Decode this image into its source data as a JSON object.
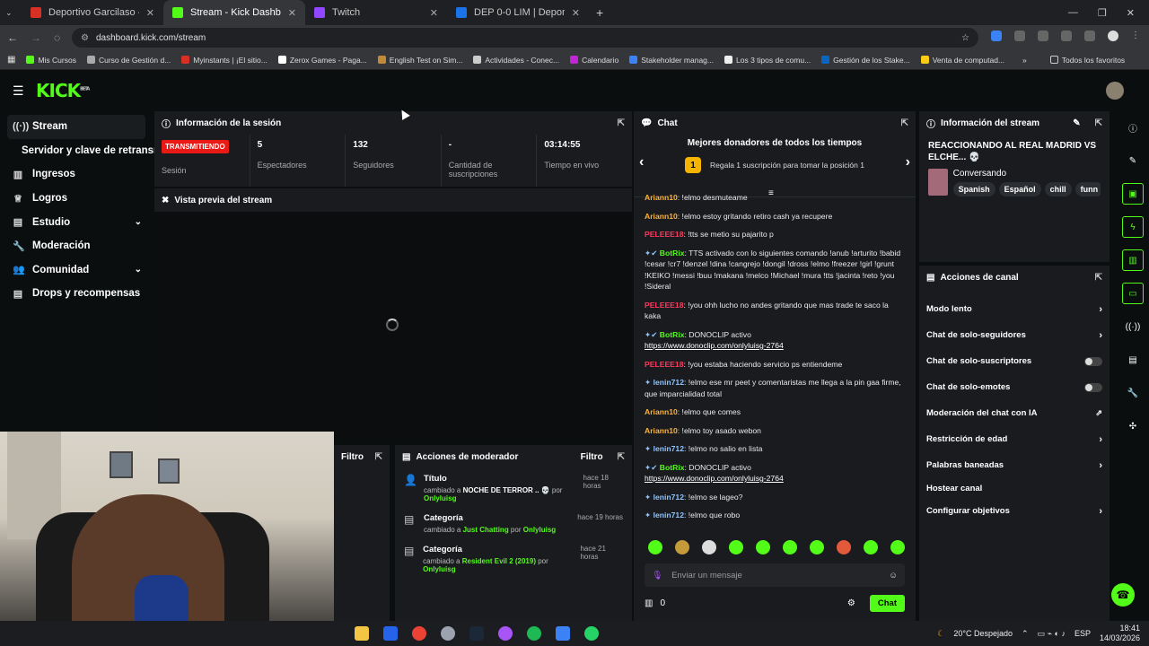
{
  "browser": {
    "tabs": [
      {
        "title": "Deportivo Garcilaso - Alianza Li",
        "color": "#d93025"
      },
      {
        "title": "Stream - Kick Dashboard",
        "color": "#53fc18"
      },
      {
        "title": "Twitch",
        "color": "#9146ff"
      },
      {
        "title": "DEP 0-0 LIM | Deportivo Garcila",
        "color": "#1a73e8"
      }
    ],
    "url": "dashboard.kick.com/stream",
    "bookmarks": [
      "Mis Cursos",
      "Curso de Gestión d...",
      "Myinstants | ¡El sitio...",
      "Zerox Games - Paga...",
      "English Test on Sim...",
      "Actividades - Conec...",
      "Calendario",
      "Stakeholder manag...",
      "Los 3 tipos de comu...",
      "Gestión de los Stake...",
      "Venta de computad..."
    ],
    "all_favorites": "Todos los favoritos"
  },
  "brand": {
    "logo": "KICK",
    "beta": "BETA",
    "accent": "#53fc18"
  },
  "sidebar": {
    "items": [
      {
        "label": "Stream",
        "icon": "broadcast-icon"
      },
      {
        "label": "Servidor y clave de retransmisión",
        "icon": ""
      },
      {
        "label": "Ingresos",
        "icon": "bar-chart-icon"
      },
      {
        "label": "Logros",
        "icon": "trophy-icon"
      },
      {
        "label": "Estudio",
        "icon": "studio-icon"
      },
      {
        "label": "Moderación",
        "icon": "wrench-icon"
      },
      {
        "label": "Comunidad",
        "icon": "people-icon"
      },
      {
        "label": "Drops y recompensas",
        "icon": "drops-icon"
      }
    ]
  },
  "session": {
    "title": "Información de la sesión",
    "live_badge": "TRANSMITIENDO",
    "session_label": "Sesión",
    "viewers_value": "5",
    "viewers_label": "Espectadores",
    "followers_value": "132",
    "followers_label": "Seguidores",
    "subs_value": "-",
    "subs_label": "Cantidad de suscripciones",
    "uptime_value": "03:14:55",
    "uptime_label": "Tiempo en vivo"
  },
  "preview": {
    "title": "Vista previa del stream"
  },
  "filter_panel": {
    "label": "Filtro"
  },
  "mod_actions": {
    "title": "Acciones de moderador",
    "filter": "Filtro",
    "items": [
      {
        "title": "Título",
        "prefix": "cambiado a ",
        "value": "NOCHE DE TERROR .. 💀",
        "by": " por ",
        "user": "Onlyluisg",
        "time": "hace 18 horas",
        "value_color": "white"
      },
      {
        "title": "Categoría",
        "prefix": "cambiado a ",
        "value": "Just Chatting",
        "by": " por ",
        "user": "Onlyluisg",
        "time": "hace 19 horas",
        "value_color": "green"
      },
      {
        "title": "Categoría",
        "prefix": "cambiado a ",
        "value": "Resident Evil 2 (2019)",
        "by": " por ",
        "user": "Onlyluisg",
        "time": "hace 21 horas",
        "value_color": "green"
      }
    ]
  },
  "chat": {
    "title": "Chat",
    "donors_title": "Mejores donadores de todos los tiempos",
    "donors_rank": "1",
    "donors_sub": "Regala 1 suscripción para tomar la posición 1",
    "messages": [
      {
        "user": "Ariann10",
        "cls": "o",
        "text": ": !elmo desmuteame"
      },
      {
        "user": "Ariann10",
        "cls": "o",
        "text": ": !elmo estoy gritando retiro cash ya recupere"
      },
      {
        "user": "PELEEE18",
        "cls": "p",
        "text": ": !tts se metio su pajarito p"
      },
      {
        "user": "BotRix",
        "cls": "g",
        "text": ": TTS activado con lo siguientes comando !anub !arturito !babid !cesar !cr7 !denzel !dina !cangrejo !dongil !dross !elmo !freezer !girl !grunt !KEIKO !messi !buu !makana !melco !Michael !mura !tts !jacinta !reto !you !Sideral"
      },
      {
        "user": "PELEEE18",
        "cls": "p",
        "text": ": !you ohh lucho no andes gritando que mas trade te saco la kaka"
      },
      {
        "user": "BotRix",
        "cls": "g",
        "text": ": DONOCLIP activo",
        "link": "https://www.donoclip.com/onlyluisg-2764"
      },
      {
        "user": "PELEEE18",
        "cls": "p",
        "text": ": !you estaba haciendo servicio ps entiendeme"
      },
      {
        "user": "lenin712",
        "cls": "b",
        "text": ": !elmo ese mr peet y comentaristas me llega a la pin gaa firme, que imparcialidad total"
      },
      {
        "user": "Ariann10",
        "cls": "o",
        "text": ": !elmo que comes"
      },
      {
        "user": "Ariann10",
        "cls": "o",
        "text": ": !elmo toy asado webon"
      },
      {
        "user": "lenin712",
        "cls": "b",
        "text": ": !elmo no salio en lista"
      },
      {
        "user": "BotRix",
        "cls": "g",
        "text": ": DONOCLIP activo",
        "link": "https://www.donoclip.com/onlyluisg-2764"
      },
      {
        "user": "lenin712",
        "cls": "b",
        "text": ": !elmo se lageo?"
      },
      {
        "user": "lenin712",
        "cls": "b",
        "text": ": !elmo que robo"
      }
    ],
    "input_placeholder": "Enviar un mensaje",
    "points": "0",
    "send_label": "Chat"
  },
  "stream_info": {
    "title": "Información del stream",
    "stream_title": "REACCIONANDO AL REAL MADRID VS ELCHE... 💀",
    "category": "Conversando",
    "tags": [
      "Spanish",
      "Español",
      "chill",
      "funn"
    ]
  },
  "channel_actions": {
    "title": "Acciones de canal",
    "items": [
      {
        "label": "Modo lento",
        "control": "arrow"
      },
      {
        "label": "Chat de solo-seguidores",
        "control": "arrow"
      },
      {
        "label": "Chat de solo-suscriptores",
        "control": "toggle"
      },
      {
        "label": "Chat de solo-emotes",
        "control": "toggle"
      },
      {
        "label": "Moderación del chat con IA",
        "control": "external"
      },
      {
        "label": "Restricción de edad",
        "control": "arrow"
      },
      {
        "label": "Palabras baneadas",
        "control": "arrow"
      },
      {
        "label": "Hostear canal",
        "control": "none"
      },
      {
        "label": "Configurar objetivos",
        "control": "arrow"
      }
    ]
  },
  "taskbar": {
    "weather": "20°C  Despejado",
    "lang": "ESP",
    "time": "18:41",
    "date": "14/03/2026"
  }
}
